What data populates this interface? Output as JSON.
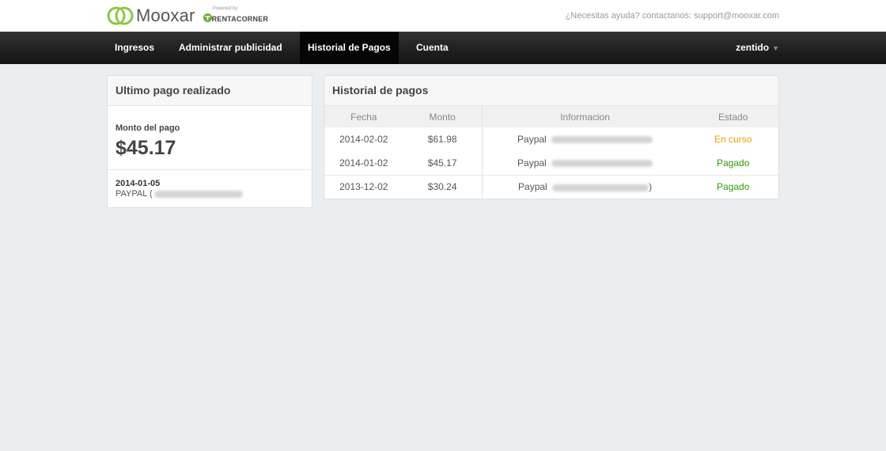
{
  "header": {
    "logo_name": "Mooxar",
    "powered_by": "Powered by",
    "partner_name": "RENTACORNER",
    "help_text": "¿Necesitas ayuda? contactanos: support@mooxar.com",
    "colors": {
      "logo_green": "#8cc63f",
      "partner_green": "#6ab02e"
    }
  },
  "nav": {
    "items": [
      {
        "label": "Ingresos"
      },
      {
        "label": "Administrar publicidad"
      },
      {
        "label": "Historial de Pagos",
        "active": true
      },
      {
        "label": "Cuenta"
      }
    ],
    "user": "zentido",
    "user_icon": "chevron-down-icon"
  },
  "last_payment": {
    "title": "Ultimo pago realizado",
    "amount_label": "Monto del pago",
    "amount": "$45.17",
    "date": "2014-01-05",
    "method_prefix": "PAYPAL ("
  },
  "history": {
    "title": "Historial de pagos",
    "columns": [
      "Fecha",
      "Monto",
      "Informacion",
      "Estado"
    ],
    "rows": [
      {
        "date": "2014-02-02",
        "amount": "$61.98",
        "info": "Paypal",
        "status": "En curso"
      },
      {
        "date": "2014-01-02",
        "amount": "$45.17",
        "info": "Paypal",
        "status": "Pagado"
      },
      {
        "date": "2013-12-02",
        "amount": "$30.24",
        "info": "Paypal",
        "status": "Pagado",
        "close_paren": ")"
      }
    ],
    "status_colors": {
      "En curso": "#e8a100",
      "Pagado": "#2e9a0c"
    }
  }
}
